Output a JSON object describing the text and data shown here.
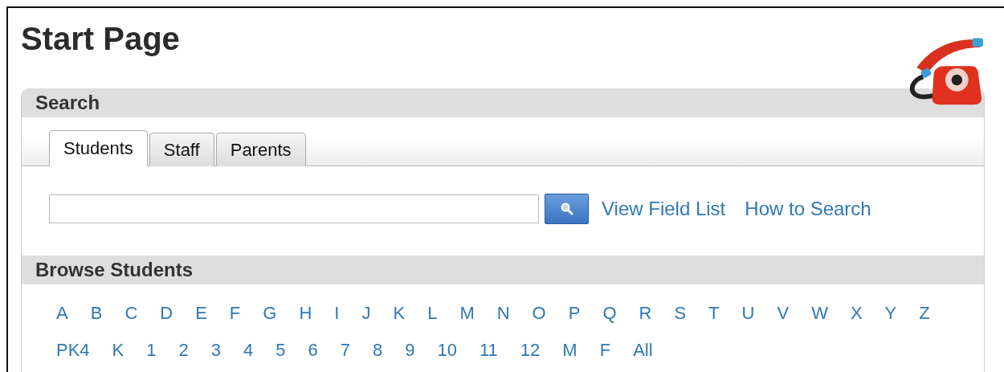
{
  "page_title": "Start Page",
  "search": {
    "title": "Search",
    "tabs": [
      {
        "label": "Students",
        "selected": true
      },
      {
        "label": "Staff",
        "selected": false
      },
      {
        "label": "Parents",
        "selected": false
      }
    ],
    "links": [
      "View Field List",
      "How to Search"
    ]
  },
  "browse": {
    "title": "Browse Students",
    "letters": [
      "A",
      "B",
      "C",
      "D",
      "E",
      "F",
      "G",
      "H",
      "I",
      "J",
      "K",
      "L",
      "M",
      "N",
      "O",
      "P",
      "Q",
      "R",
      "S",
      "T",
      "U",
      "V",
      "W",
      "X",
      "Y",
      "Z"
    ],
    "grades": [
      "PK4",
      "K",
      "1",
      "2",
      "3",
      "4",
      "5",
      "6",
      "7",
      "8",
      "9",
      "10",
      "11",
      "12",
      "M",
      "F",
      "All"
    ]
  }
}
